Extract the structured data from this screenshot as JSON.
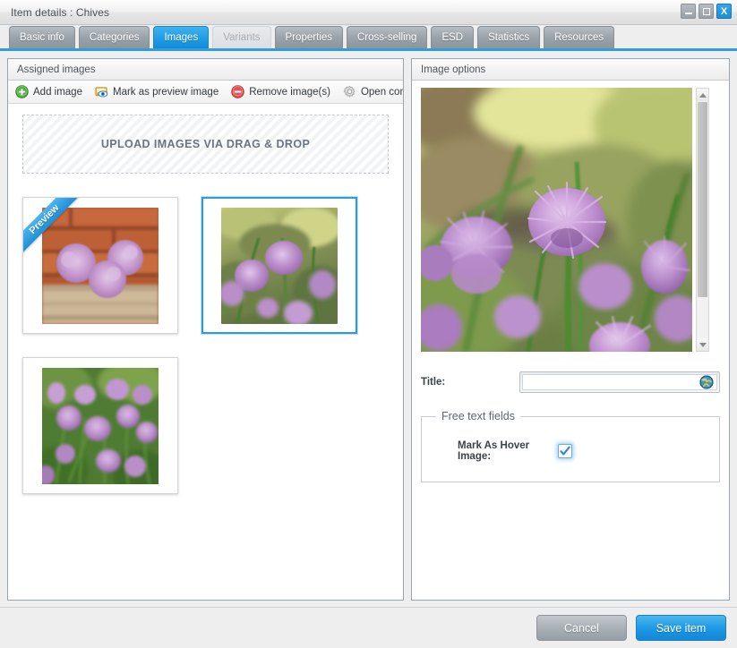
{
  "window": {
    "title": "Item details : Chives",
    "controls": [
      {
        "name": "minimize",
        "label": ""
      },
      {
        "name": "maximize",
        "label": ""
      },
      {
        "name": "close",
        "label": "X"
      }
    ]
  },
  "tabs": [
    {
      "label": "Basic info",
      "state": "normal"
    },
    {
      "label": "Categories",
      "state": "normal"
    },
    {
      "label": "Images",
      "state": "active"
    },
    {
      "label": "Variants",
      "state": "disabled"
    },
    {
      "label": "Properties",
      "state": "normal"
    },
    {
      "label": "Cross-selling",
      "state": "normal"
    },
    {
      "label": "ESD",
      "state": "normal"
    },
    {
      "label": "Statistics",
      "state": "normal"
    },
    {
      "label": "Resources",
      "state": "normal"
    }
  ],
  "left_panel": {
    "header": "Assigned images",
    "toolbar": [
      {
        "label": "Add image",
        "icon": "add-circle-icon"
      },
      {
        "label": "Mark as preview image",
        "icon": "preview-image-icon"
      },
      {
        "label": "Remove image(s)",
        "icon": "remove-circle-icon"
      },
      {
        "label": "Open configu",
        "icon": "gear-icon"
      }
    ],
    "dropzone_label": "UPLOAD IMAGES VIA DRAG & DROP",
    "thumbnails": [
      {
        "alt": "Chive flowers on wood with brick wall",
        "badge": "Preview",
        "selected": false
      },
      {
        "alt": "Single purple chive flower close-up",
        "badge": "",
        "selected": true
      },
      {
        "alt": "Field of purple chive flowers",
        "badge": "",
        "selected": false
      }
    ]
  },
  "right_panel": {
    "header": "Image options",
    "preview_alt": "Purple chive flowers in a garden",
    "title_field": {
      "label": "Title:",
      "value": "",
      "placeholder": "",
      "translate_icon": "globe-icon"
    },
    "free_text_fields": {
      "legend": "Free text fields",
      "rows": [
        {
          "label": "Mark As Hover Image:",
          "checked": true
        }
      ]
    },
    "scrollbar": {
      "up": "scroll-up-arrow",
      "down": "scroll-down-arrow"
    }
  },
  "footer": {
    "cancel_label": "Cancel",
    "save_label": "Save item"
  },
  "colors": {
    "accent": "#1f9ae4",
    "tab_inactive": "#9ba3aa",
    "panel_border": "#9aa5ae",
    "add_icon_green": "#3f9e3f",
    "remove_icon_red": "#dd4b4b"
  }
}
